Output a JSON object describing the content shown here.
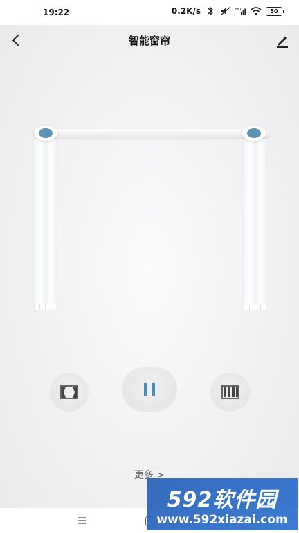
{
  "status_bar": {
    "time": "19:22",
    "net_speed": "0.2K/s",
    "battery": "50",
    "icons": [
      "bluetooth-icon",
      "mute-icon",
      "hd-signal-icon",
      "wifi-icon",
      "battery-icon"
    ]
  },
  "header": {
    "title": "智能窗帘",
    "back_icon": "chevron-left-icon",
    "edit_icon": "pencil-icon"
  },
  "controls": {
    "open_icon": "curtain-open-icon",
    "pause_icon": "pause-icon",
    "close_icon": "curtain-close-icon"
  },
  "more_label": "更多 >",
  "watermark": {
    "brand": "592软件园",
    "url": "www.592xiazai.com"
  },
  "colors": {
    "accent": "#5f93b3",
    "watermark_bg": "#2d6cc4"
  }
}
